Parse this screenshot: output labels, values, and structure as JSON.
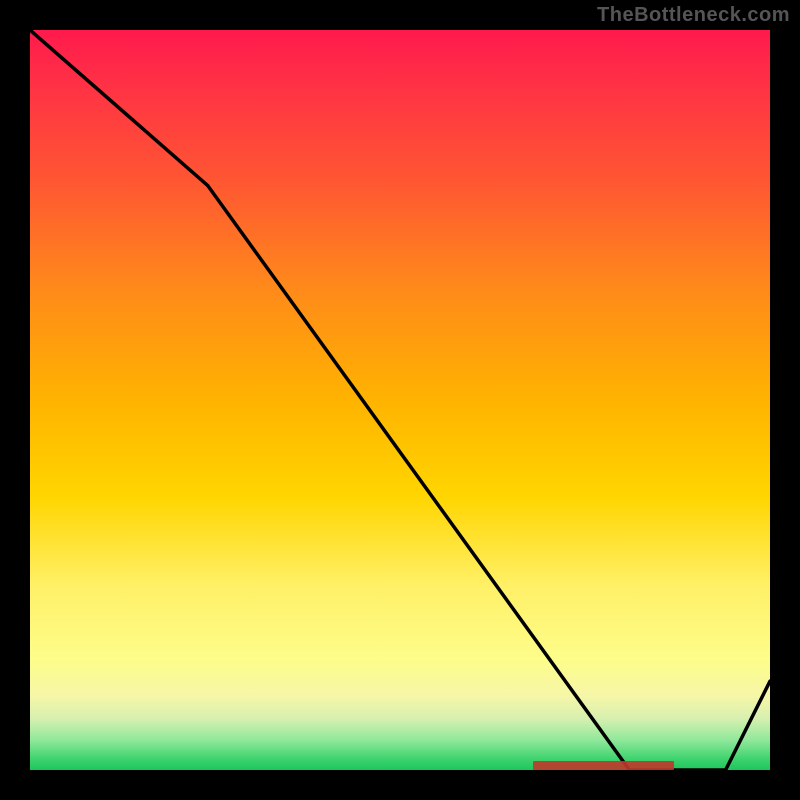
{
  "watermark": "TheBottleneck.com",
  "colors": {
    "background": "#000000",
    "line": "#000000",
    "marker": "#c0392b"
  },
  "chart_data": {
    "type": "line",
    "title": "",
    "xlabel": "",
    "ylabel": "",
    "xlim": [
      0,
      100
    ],
    "ylim": [
      0,
      100
    ],
    "grid": false,
    "series": [
      {
        "name": "curve",
        "x": [
          0,
          24,
          81,
          94,
          100
        ],
        "values": [
          100,
          79,
          0,
          0,
          12
        ]
      }
    ],
    "annotations": [
      {
        "name": "recommended-marker",
        "x_start": 68,
        "x_end": 87,
        "y": 0
      }
    ]
  }
}
